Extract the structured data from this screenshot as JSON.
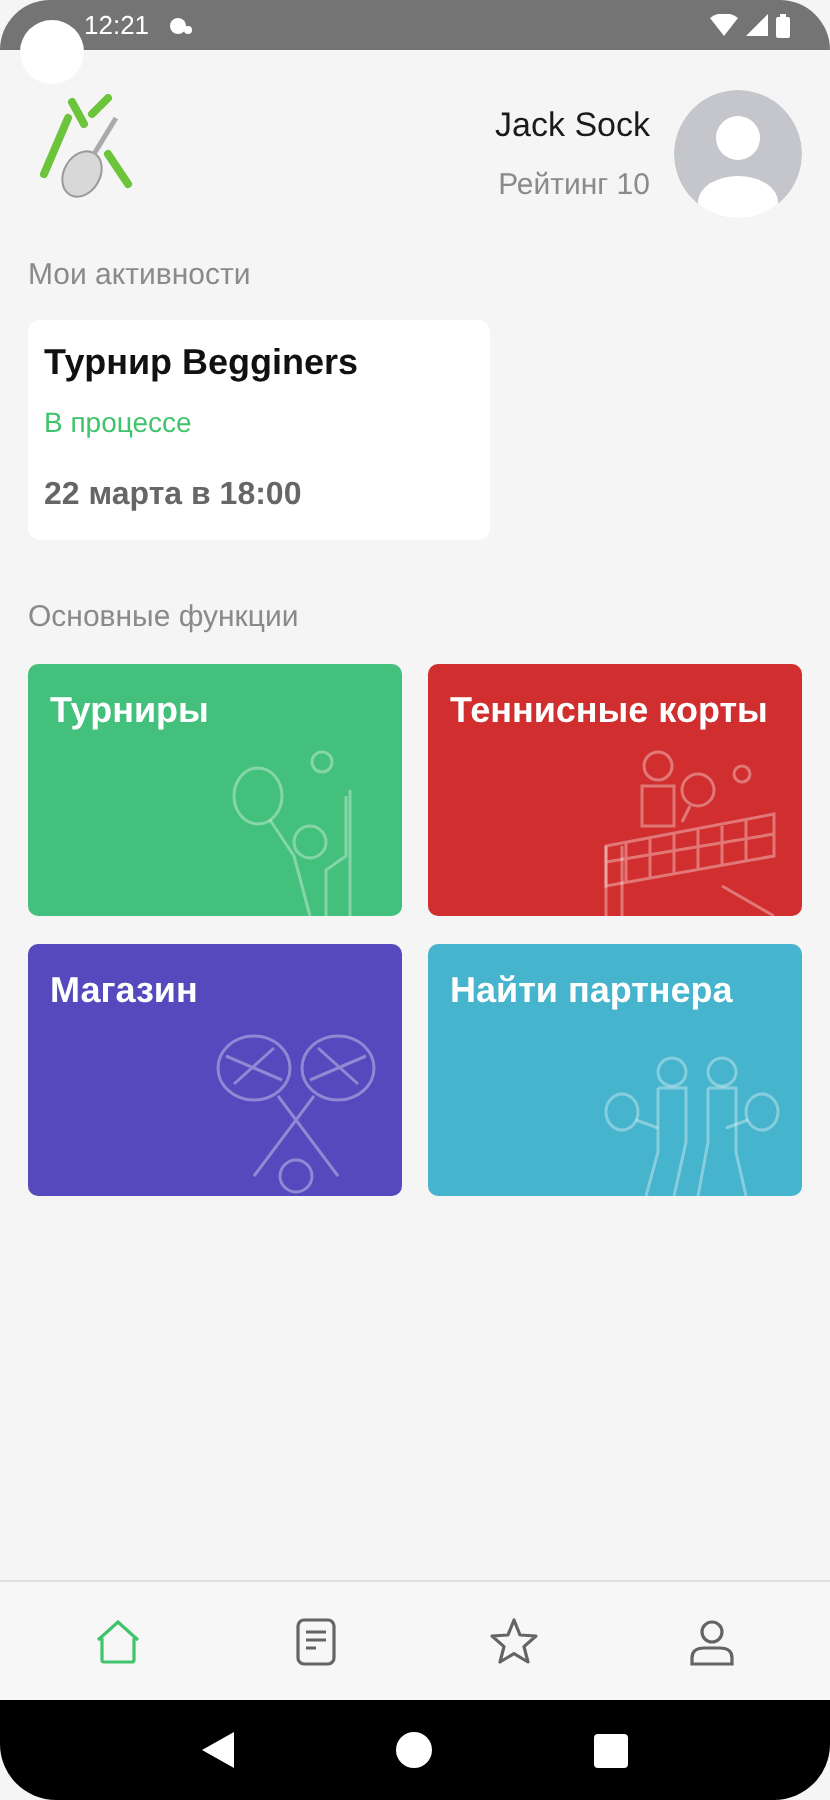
{
  "status_bar": {
    "time": "12:21"
  },
  "profile": {
    "name": "Jack Sock",
    "rating": "Рейтинг 10"
  },
  "activities": {
    "title": "Мои активности",
    "items": [
      {
        "name": "Турнир Begginers",
        "status": "В процессе",
        "date": "22 марта в 18:00"
      }
    ]
  },
  "functions": {
    "title": "Основные функции",
    "items": [
      {
        "label": "Турниры",
        "color": "#43c07b",
        "kind": "player"
      },
      {
        "label": "Теннисные корты",
        "color": "#d12f2f",
        "kind": "net"
      },
      {
        "label": "Магазин",
        "color": "#5649bd",
        "kind": "rackets"
      },
      {
        "label": "Найти партнера",
        "color": "#45b4cc",
        "kind": "partners"
      }
    ]
  },
  "bottom_nav": [
    {
      "kind": "home",
      "selected": true
    },
    {
      "kind": "document",
      "selected": false
    },
    {
      "kind": "star",
      "selected": false
    },
    {
      "kind": "profile",
      "selected": false
    }
  ]
}
